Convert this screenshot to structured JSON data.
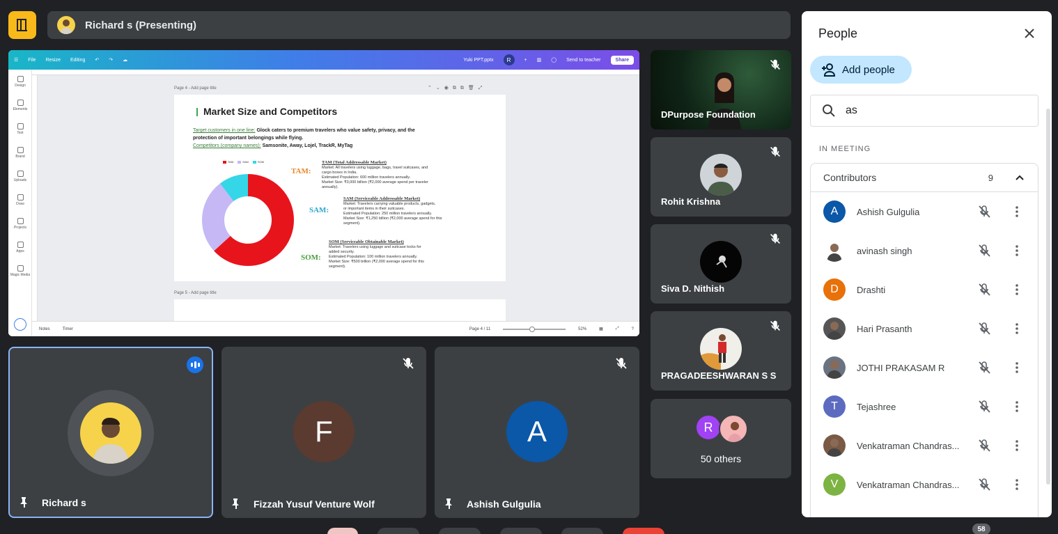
{
  "header": {
    "presenter_text": "Richard s (Presenting)"
  },
  "presentation": {
    "toolbar": {
      "file": "File",
      "resize": "Resize",
      "editing": "Editing",
      "doc_name": "Yuki PPT.pptx",
      "avatar_letter": "R",
      "send_to_teacher": "Send to teacher",
      "share": "Share"
    },
    "tools": [
      "Design",
      "Elements",
      "Text",
      "Brand",
      "Uploads",
      "Draw",
      "Projects",
      "Apps",
      "Magic Media"
    ],
    "page4_label": "Page 4 - Add page title",
    "page5_label": "Page 5 - Add page title",
    "slide": {
      "title": "Market Size and Competitors",
      "target_label": "Target customers in one line:",
      "target_text": "Glock caters to premium travelers who value safety, privacy, and the",
      "target_text2": "protection of important belongings while flying.",
      "competitors_label": "Competitors (company names):",
      "competitors_text": "Samsonite, Away, Lojel, TrackR, MyTag",
      "legend": [
        "TAM",
        "SAM",
        "SOM"
      ],
      "tam_label": "TAM:",
      "sam_label": "SAM:",
      "som_label": "SOM:",
      "tam_title": "TAM (Total Addressable Market)",
      "tam_lines": [
        "Market: All travelers using luggage, bags, travel suitcases, and",
        "cargo boxes in India.",
        "Estimated Population: 600 million travelers annually.",
        "Market Size: ₹3,000 billion (₹2,000 average spend per traveler",
        "annually)."
      ],
      "sam_title": "SAM (Serviceable Addressable Market)",
      "sam_lines": [
        "Market: Travelers carrying valuable products, gadgets,",
        "or important items in their suitcases.",
        "Estimated Population: 250 million travelers annually.",
        "Market Size: ₹1,250 billion (₹2,000 average spend for this",
        "segment)."
      ],
      "som_title": "SOM (Serviceable Obtainable Market)",
      "som_lines": [
        "Market: Travelers using luggage and suitcase locks for",
        "added security.",
        "Estimated Population: 100 million travelers annually.",
        "Market Size: ₹500 billion (₹2,000 average spend for this",
        "segment)."
      ]
    },
    "bottom": {
      "notes": "Notes",
      "timer": "Timer",
      "page_indicator": "Page 4 / 11",
      "zoom": "52%"
    }
  },
  "chart_data": {
    "type": "pie",
    "categories": [
      "TAM",
      "SAM",
      "SOM"
    ],
    "values": [
      3000,
      1250,
      500
    ],
    "colors": [
      "#e8141c",
      "#c5b8f5",
      "#35d6e8"
    ]
  },
  "main_tiles": [
    {
      "name": "Richard s",
      "speaking": true
    },
    {
      "name": "Fizzah Yusuf Venture Wolf",
      "initial": "F",
      "color": "#5b3a30"
    },
    {
      "name": "Ashish Gulgulia",
      "initial": "A",
      "color": "#0b57a8"
    }
  ],
  "side_tiles": [
    {
      "name": "DPurpose Foundation"
    },
    {
      "name": "Rohit Krishna"
    },
    {
      "name": "Siva D. Nithish"
    },
    {
      "name": "PRAGADEESHWARAN S S"
    },
    {
      "name": "50 others",
      "initial": "R"
    }
  ],
  "people_panel": {
    "title": "People",
    "add_people": "Add people",
    "search_value": "as",
    "section_label": "IN MEETING",
    "group_label": "Contributors",
    "group_count": "9",
    "people": [
      {
        "name": "Ashish Gulgulia",
        "initial": "A",
        "color": "#0b57a8"
      },
      {
        "name": "avinash singh",
        "initial": "",
        "color": "#ffffff"
      },
      {
        "name": "Drashti",
        "initial": "D",
        "color": "#e8710a"
      },
      {
        "name": "Hari Prasanth",
        "initial": "",
        "color": "#555555"
      },
      {
        "name": "JOTHI PRAKASAM R",
        "initial": "",
        "color": "#6b7280"
      },
      {
        "name": "Tejashree",
        "initial": "T",
        "color": "#5c6bc0"
      },
      {
        "name": "Venkatraman Chandras...",
        "initial": "",
        "color": "#7a5a45"
      },
      {
        "name": "Venkatraman Chandras...",
        "initial": "V",
        "color": "#7cb342"
      }
    ]
  },
  "participant_count": "58"
}
